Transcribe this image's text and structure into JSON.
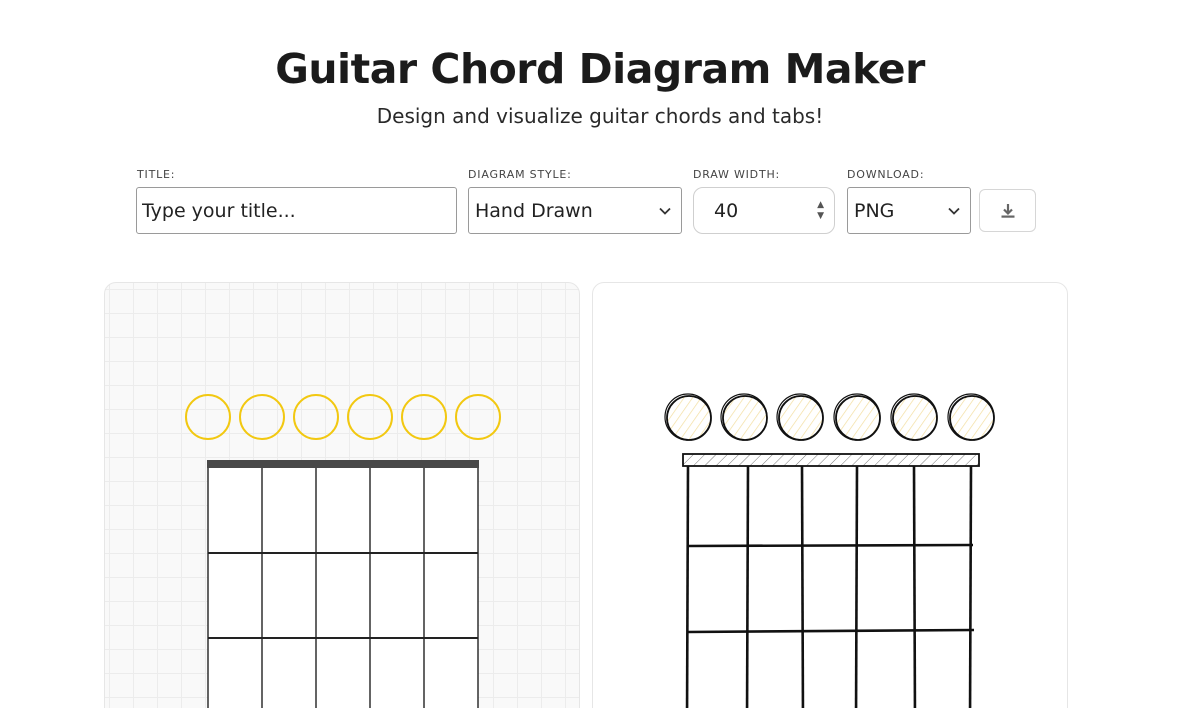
{
  "header": {
    "title": "Guitar Chord Diagram Maker",
    "subtitle": "Design and visualize guitar chords and tabs!"
  },
  "controls": {
    "title_label": "TITLE:",
    "title_placeholder": "Type your title...",
    "title_value": "",
    "style_label": "DIAGRAM STYLE:",
    "style_value": "Hand Drawn",
    "width_label": "DRAW WIDTH:",
    "width_value": "40",
    "download_label": "DOWNLOAD:",
    "download_value": "PNG",
    "download_icon": "download-icon"
  },
  "diagrams": {
    "strings": 6,
    "accent_color": "#f2c811",
    "grid_card_style": "clean",
    "sketch_card_style": "hand-drawn"
  }
}
